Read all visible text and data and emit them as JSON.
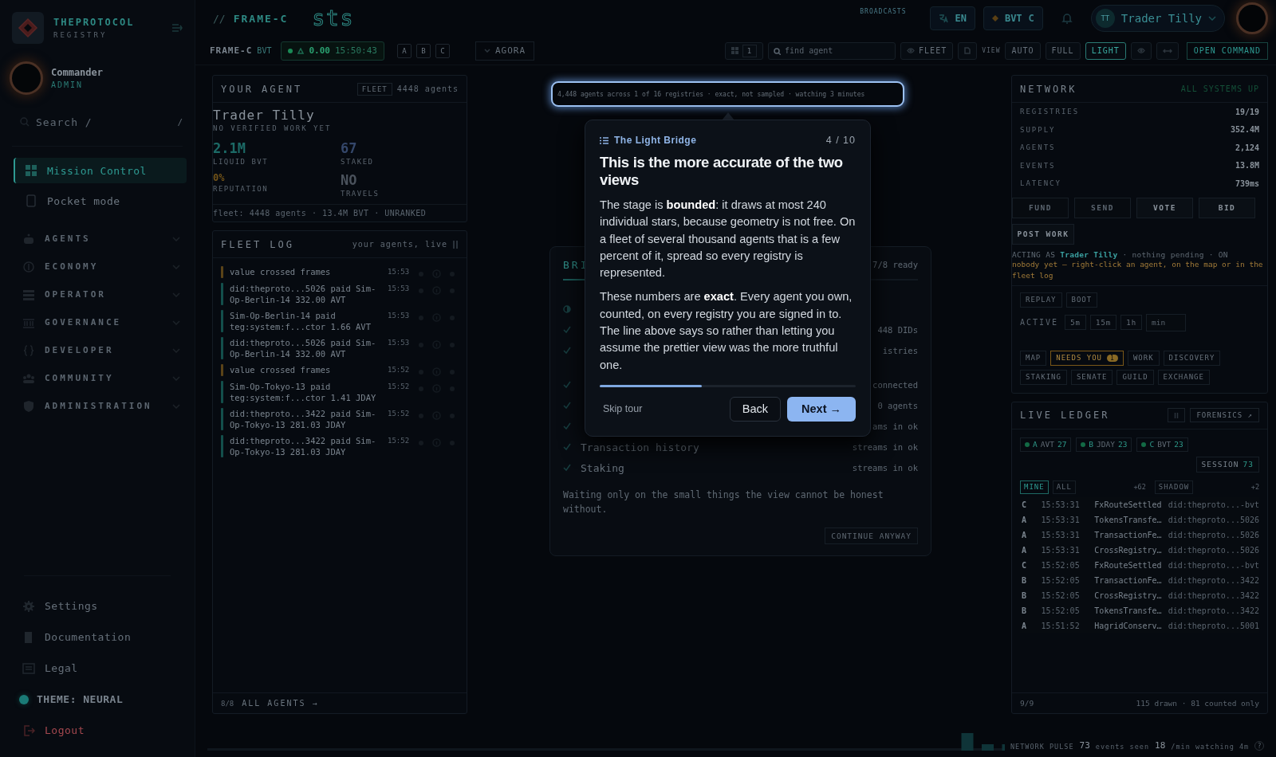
{
  "sidebar": {
    "brand": "THEPROTOCOL",
    "brand_sub": "REGISTRY",
    "user": {
      "name": "Commander",
      "role": "ADMIN"
    },
    "search": {
      "placeholder": "Search  /",
      "shortcut": "/"
    },
    "items": [
      {
        "label": "Mission Control",
        "selected": true
      },
      {
        "label": "Pocket mode",
        "selected": false
      }
    ],
    "groups": [
      {
        "label": "AGENTS",
        "expanded": false
      },
      {
        "label": "ECONOMY",
        "expanded": false
      },
      {
        "label": "OPERATOR",
        "expanded": false
      },
      {
        "label": "GOVERNANCE",
        "expanded": false
      },
      {
        "label": "DEVELOPER",
        "expanded": false
      },
      {
        "label": "COMMUNITY",
        "expanded": false
      },
      {
        "label": "ADMINISTRATION",
        "expanded": false
      }
    ],
    "footer": [
      {
        "label": "Settings",
        "kind": "link"
      },
      {
        "label": "Documentation",
        "kind": "link"
      },
      {
        "label": "Legal",
        "kind": "link"
      },
      {
        "label": "THEME: NEURAL",
        "kind": "theme"
      },
      {
        "label": "Logout",
        "kind": "danger"
      }
    ]
  },
  "topbar": {
    "crumb_sep": "//",
    "crumb": "FRAME-C",
    "logo_text": "sts",
    "broadcasts": "BROADCASTS",
    "language": "EN",
    "currency": {
      "label": "BVT",
      "frame": "C"
    },
    "user": {
      "initials": "TT",
      "name": "Trader Tilly"
    }
  },
  "toolbar": {
    "frame": "FRAME-C",
    "token": "BVT",
    "ticker": {
      "value": "0.00",
      "time": "15:50:43"
    },
    "frames": [
      {
        "label": "A",
        "selected": false
      },
      {
        "label": "B",
        "selected": false
      },
      {
        "label": "C",
        "selected": false
      }
    ],
    "channel": "AGORA",
    "count": "1",
    "search": {
      "placeholder": "find agent"
    },
    "fleet": "FLEET",
    "view_label": "VIEW",
    "views": [
      {
        "label": "AUTO",
        "selected": false
      },
      {
        "label": "FULL",
        "selected": false
      },
      {
        "label": "LIGHT",
        "selected": true
      }
    ],
    "open_command": "OPEN COMMAND"
  },
  "agent": {
    "title": "YOUR AGENT",
    "scope": "FLEET",
    "count": "4448 agents",
    "name": "Trader Tilly",
    "subtitle": "NO VERIFIED WORK YET",
    "stats": [
      {
        "value": "2.1M",
        "label": "LIQUID BVT",
        "color": "#1c6a66"
      },
      {
        "value": "67",
        "label": "STAKED",
        "color": "#34476a"
      },
      {
        "value": "0%",
        "label": "REPUTATION",
        "color": "#735419"
      },
      {
        "value": "NO",
        "label": "TRAVELS",
        "color": "#4a525c"
      }
    ],
    "footer": "fleet: 4448 agents · 13.4M BVT · UNRANKED"
  },
  "fleet_log": {
    "title": "FLEET LOG",
    "subtitle": "your agents, live",
    "entries": [
      {
        "text": "value crossed frames",
        "time": "15:53",
        "kind": "frame"
      },
      {
        "text": "did:theproto...5026 paid Sim-Op-Berlin-14 332.00 AVT",
        "time": "15:53",
        "kind": "payment"
      },
      {
        "text": "Sim-Op-Berlin-14 paid teg:system:f...ctor 1.66 AVT",
        "time": "15:53",
        "kind": "payment"
      },
      {
        "text": "did:theproto...5026 paid Sim-Op-Berlin-14 332.00 AVT",
        "time": "15:53",
        "kind": "payment"
      },
      {
        "text": "value crossed frames",
        "time": "15:52",
        "kind": "frame"
      },
      {
        "text": "Sim-Op-Tokyo-13 paid teg:system:f...ctor 1.41 JDAY",
        "time": "15:52",
        "kind": "payment"
      },
      {
        "text": "did:theproto...3422 paid Sim-Op-Tokyo-13 281.03 JDAY",
        "time": "15:52",
        "kind": "payment"
      },
      {
        "text": "did:theproto...3422 paid Sim-Op-Tokyo-13 281.03 JDAY",
        "time": "15:52",
        "kind": "payment"
      }
    ],
    "count": "8/8",
    "all_link": "ALL AGENTS →"
  },
  "fleet_stars": {
    "summary": "4,448 agents across 1 of 16 registries · exact, not sampled · watching 3 minutes"
  },
  "bridge": {
    "title": "BRI",
    "ready": "7/8 ready",
    "rows": [
      {
        "kind": "pending"
      },
      {
        "kind": "done",
        "status": "448 DIDs"
      },
      {
        "kind": "done",
        "status": "istries"
      },
      {
        "kind": "done",
        "status": "connected"
      },
      {
        "kind": "done",
        "status": "0 agents"
      },
      {
        "kind": "done",
        "status": "ams in ok"
      },
      {
        "kind": "done",
        "label": "Transaction history",
        "status": "streams in ok"
      },
      {
        "kind": "done",
        "label": "Staking",
        "status": "streams in ok"
      }
    ],
    "note": "Waiting only on the small things the view cannot be honest without.",
    "continue": "CONTINUE ANYWAY"
  },
  "tour": {
    "section": "The Light Bridge",
    "step": "4 / 10",
    "title": "This is the more accurate of the two views",
    "paragraphs": [
      "The stage is **bounded**: it draws at most 240 individual stars, because geometry is not free. On a fleet of several thousand agents that is a few percent of it, spread so every registry is represented.",
      "These numbers are **exact**. Every agent you own, counted, on every registry you are signed in to. The line above says so rather than letting you assume the prettier view was the more truthful one."
    ],
    "progress": {
      "level": 0.4
    },
    "skip": "Skip tour",
    "back": "Back",
    "next": "Next →"
  },
  "network": {
    "title": "NETWORK",
    "status": "ALL SYSTEMS UP",
    "stats": [
      {
        "label": "REGISTRIES",
        "value": "19/19"
      },
      {
        "label": "SUPPLY",
        "value": "352.4M"
      },
      {
        "label": "AGENTS",
        "value": "2,124"
      },
      {
        "label": "EVENTS",
        "value": "13.8M"
      },
      {
        "label": "LATENCY",
        "value": "739ms"
      }
    ],
    "actions": [
      {
        "label": "FUND",
        "disabled": true
      },
      {
        "label": "SEND",
        "disabled": true
      },
      {
        "label": "VOTE",
        "disabled": false
      },
      {
        "label": "BID",
        "disabled": false
      },
      {
        "label": "POST WORK",
        "disabled": false
      }
    ],
    "acting": {
      "prefix": "ACTING AS",
      "agent": "Trader Tilly",
      "suffix": "· nothing pending · ON"
    },
    "hint": "nobody yet — right-click an agent, on the map or in the fleet log",
    "controls": [
      "REPLAY",
      "BOOT"
    ],
    "active_label": "ACTIVE",
    "ranges": [
      "5m",
      "15m",
      "1h"
    ],
    "range_field": {
      "placeholder": "min"
    },
    "tabs": [
      {
        "label": "MAP",
        "selected": false
      },
      {
        "label": "NEEDS YOU",
        "badge": "1",
        "selected": true
      },
      {
        "label": "WORK",
        "selected": false
      },
      {
        "label": "DISCOVERY",
        "selected": false
      },
      {
        "label": "STAKING",
        "selected": false
      },
      {
        "label": "SENATE",
        "selected": false
      },
      {
        "label": "GUILD",
        "selected": false
      },
      {
        "label": "EXCHANGE",
        "selected": false
      }
    ]
  },
  "ledger": {
    "title": "LIVE LEDGER",
    "forensics": "FORENSICS ↗",
    "frames": [
      {
        "letter": "A",
        "token": "AVT",
        "count": "27"
      },
      {
        "letter": "B",
        "token": "JDAY",
        "count": "23"
      },
      {
        "letter": "C",
        "token": "BVT",
        "count": "23"
      }
    ],
    "session": {
      "label": "SESSION",
      "count": "73"
    },
    "filters": [
      {
        "label": "MINE",
        "selected": true
      },
      {
        "label": "ALL",
        "selected": false
      }
    ],
    "more": "+62",
    "shadow": "SHADOW",
    "shadow_count": "+2",
    "rows": [
      {
        "frame": "C",
        "time": "15:53:31",
        "event": "FxRouteSettled",
        "did": "did:theproto...-bvt"
      },
      {
        "frame": "A",
        "time": "15:53:31",
        "event": "TokensTransfe…",
        "did": "did:theproto...5026"
      },
      {
        "frame": "A",
        "time": "15:53:31",
        "event": "TransactionFe…",
        "did": "did:theproto...5026"
      },
      {
        "frame": "A",
        "time": "15:53:31",
        "event": "CrossRegistry…",
        "did": "did:theproto...5026"
      },
      {
        "frame": "C",
        "time": "15:52:05",
        "event": "FxRouteSettled",
        "did": "did:theproto...-bvt"
      },
      {
        "frame": "B",
        "time": "15:52:05",
        "event": "TransactionFe…",
        "did": "did:theproto...3422"
      },
      {
        "frame": "B",
        "time": "15:52:05",
        "event": "CrossRegistry…",
        "did": "did:theproto...3422"
      },
      {
        "frame": "B",
        "time": "15:52:05",
        "event": "TokensTransfe…",
        "did": "did:theproto...3422"
      },
      {
        "frame": "A",
        "time": "15:51:52",
        "event": "HagridConserv…",
        "did": "did:theproto...5001"
      }
    ],
    "footer_count": "9/9",
    "footer_note": "115 drawn · 81 counted only"
  },
  "pulse": {
    "label": "NETWORK PULSE",
    "events": "73",
    "events_label": "events seen",
    "rate": "18",
    "rate_label": "/min watching 4m",
    "help": "?"
  }
}
